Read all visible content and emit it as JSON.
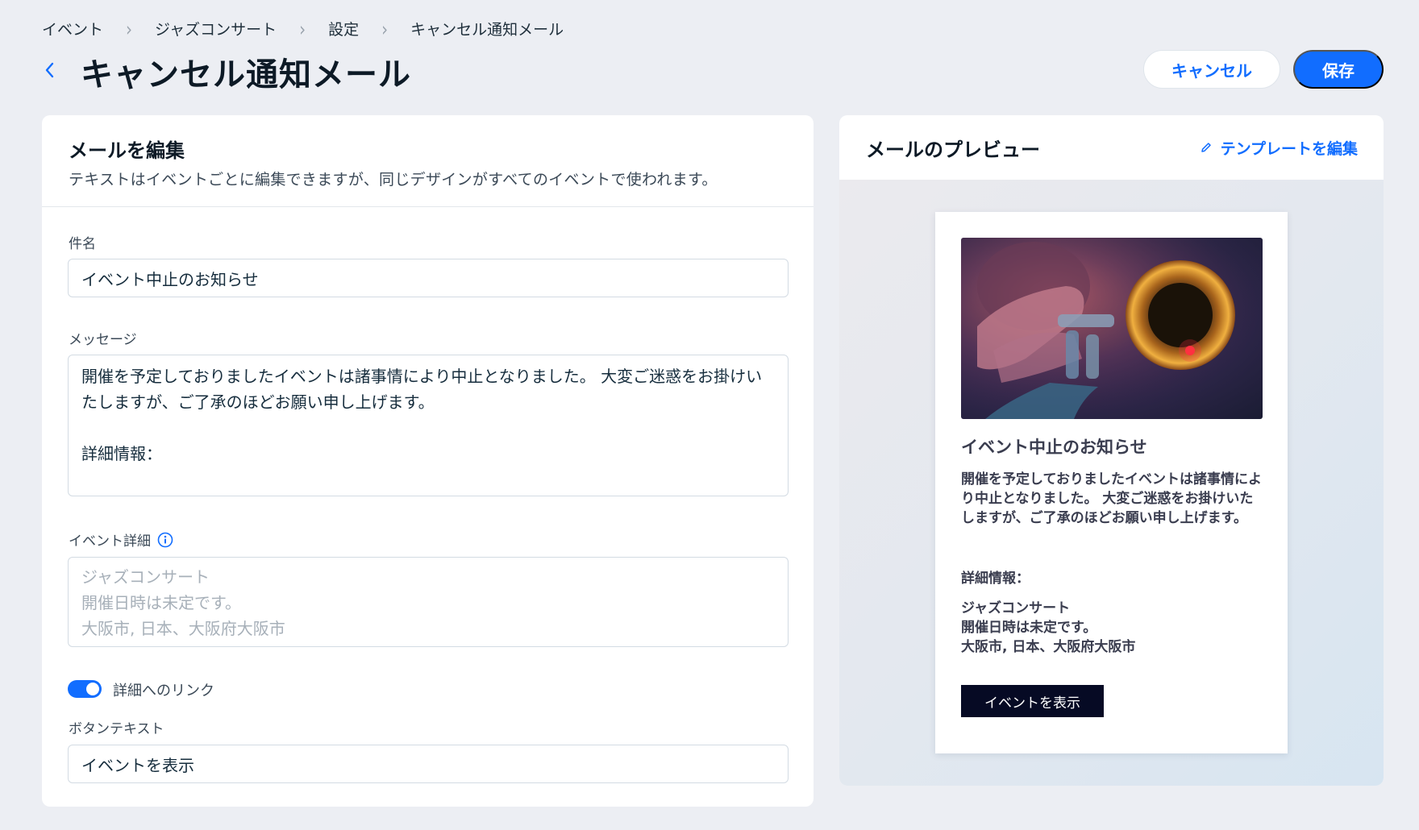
{
  "breadcrumb": [
    "イベント",
    "ジャズコンサート",
    "設定",
    "キャンセル通知メール"
  ],
  "header": {
    "title": "キャンセル通知メール",
    "cancel_label": "キャンセル",
    "save_label": "保存"
  },
  "editor": {
    "title": "メールを編集",
    "subtitle": "テキストはイベントごとに編集できますが、同じデザインがすべてのイベントで使われます。",
    "subject_label": "件名",
    "subject_value": "イベント中止のお知らせ",
    "message_label": "メッセージ",
    "message_value": "開催を予定しておりましたイベントは諸事情により中止となりました。 大変ご迷惑をお掛けいたしますが、ご了承のほどお願い申し上げます。\n\n詳細情報：",
    "event_details_label": "イベント詳細",
    "event_details_lines": [
      "ジャズコンサート",
      "開催日時は未定です。",
      "大阪市, 日本、大阪府大阪市"
    ],
    "link_toggle_label": "詳細へのリンク",
    "link_toggle_on": true,
    "button_text_label": "ボタンテキスト",
    "button_text_value": "イベントを表示"
  },
  "preview": {
    "title": "メールのプレビュー",
    "edit_template_label": "テンプレートを編集",
    "email_heading": "イベント中止のお知らせ",
    "email_body": "開催を予定しておりましたイベントは諸事情により中止となりました。 大変ご迷惑をお掛けいたしますが、ご了承のほどお願い申し上げます。",
    "email_details_label": "詳細情報：",
    "email_details_lines": [
      "ジャズコンサート",
      "開催日時は未定です。",
      "大阪市, 日本、大阪府大阪市"
    ],
    "email_button_label": "イベントを表示"
  },
  "colors": {
    "accent": "#116dff",
    "page_bg": "#eceef3",
    "email_button_bg": "#060a24"
  },
  "icons": [
    "chevron-left-icon",
    "info-icon",
    "pencil-icon",
    "chevron-right-icon"
  ]
}
